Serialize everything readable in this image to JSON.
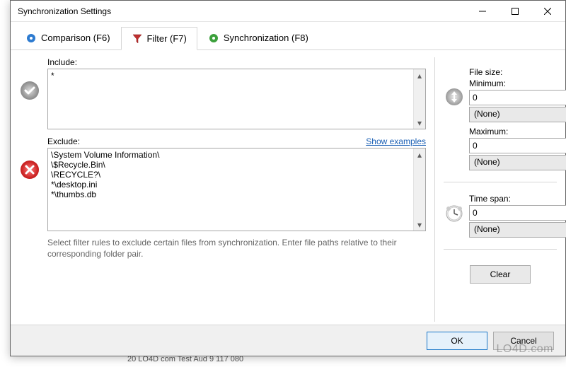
{
  "window": {
    "title": "Synchronization Settings"
  },
  "tabs": {
    "comparison": "Comparison (F6)",
    "filter": "Filter (F7)",
    "sync": "Synchronization (F8)"
  },
  "include": {
    "label": "Include:",
    "value": "*"
  },
  "exclude": {
    "label": "Exclude:",
    "link": "Show examples",
    "value": "\\System Volume Information\\\n\\$Recycle.Bin\\\n\\RECYCLE?\\\n*\\desktop.ini\n*\\thumbs.db"
  },
  "help": "Select filter rules to exclude certain files from synchronization. Enter file paths relative to their corresponding folder pair.",
  "filesize": {
    "label": "File size:",
    "min_label": "Minimum:",
    "min_value": "0",
    "min_unit": "(None)",
    "max_label": "Maximum:",
    "max_value": "0",
    "max_unit": "(None)"
  },
  "timespan": {
    "label": "Time span:",
    "value": "0",
    "unit": "(None)"
  },
  "buttons": {
    "clear": "Clear",
    "ok": "OK",
    "cancel": "Cancel"
  },
  "watermark": "LO4D.com",
  "backdrop_partial": "20    LO4D com    Test Aud         9 117 080"
}
